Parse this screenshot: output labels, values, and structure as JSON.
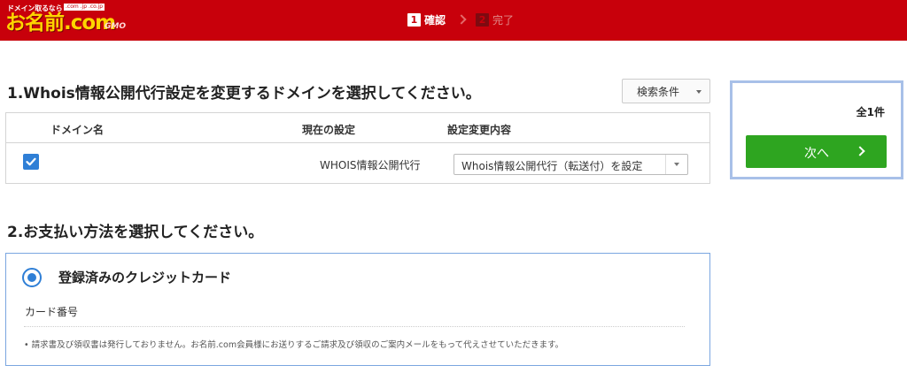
{
  "header": {
    "logo": {
      "tagline": "ドメイン取るなら",
      "tlds": ".com .jp .co.jp",
      "main": "お名前.com",
      "gmo": "GMO"
    },
    "steps": [
      {
        "num": "1",
        "label": "確認",
        "active": true
      },
      {
        "num": "2",
        "label": "完了",
        "active": false
      }
    ]
  },
  "section1": {
    "title": "1.Whois情報公開代行設定を変更するドメインを選択してください。",
    "search_button": "検索条件",
    "table": {
      "headers": [
        "ドメイン名",
        "現在の設定",
        "設定変更内容"
      ],
      "rows": [
        {
          "checked": true,
          "domain": "",
          "current_setting": "WHOIS情報公開代行",
          "change_select": "Whois情報公開代行（転送付）を設定"
        }
      ]
    }
  },
  "side_panel": {
    "total": "全1件",
    "next_label": "次へ"
  },
  "section2": {
    "title": "2.お支払い方法を選択してください。",
    "payment_option": "登録済みのクレジットカード",
    "card_label": "カード番号",
    "note": "• 請求書及び領収書は発行しておりません。お名前.com会員様にお送りするご請求及び領収のご案内メールをもって代えさせていただきます。"
  },
  "colors": {
    "header_red": "#c8000b",
    "logo_yellow": "#ffd400",
    "accent_blue": "#2f7fd6",
    "next_green": "#2ea520",
    "panel_border": "#a8c0e8"
  }
}
